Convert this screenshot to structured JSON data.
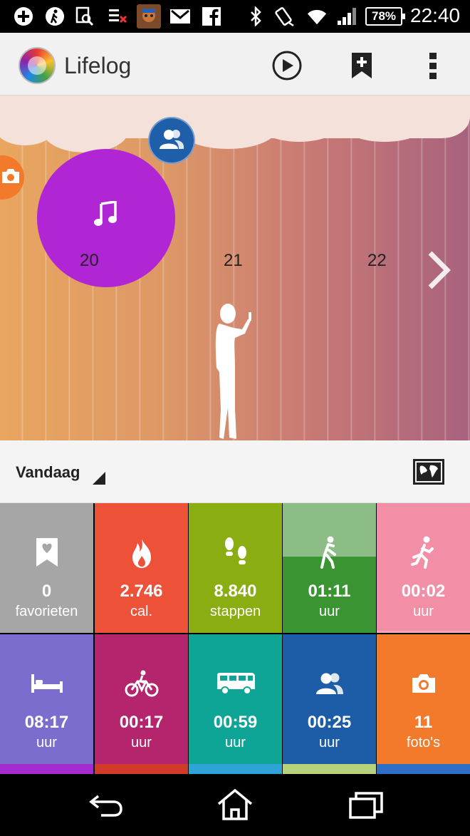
{
  "status_bar": {
    "battery": "78%",
    "time": "22:40"
  },
  "action_bar": {
    "title": "Lifelog",
    "play_icon": "play-circle-icon",
    "bookmark_icon": "bookmark-add-icon",
    "overflow_icon": "overflow-menu-icon"
  },
  "timeline": {
    "days": [
      "20",
      "21",
      "22"
    ],
    "bubbles": [
      "camera-icon",
      "music-note-icon",
      "people-icon"
    ],
    "colors": {
      "music": "#b026d4",
      "people": "#1f5ea8",
      "camera": "#f27a2a"
    }
  },
  "date_header": {
    "label": "Vandaag",
    "map_icon": "world-map-icon"
  },
  "tiles": [
    {
      "value": "0",
      "unit": "favorieten",
      "icon": "bookmark-heart-icon",
      "color": "#a6a6a6"
    },
    {
      "value": "2.746",
      "unit": "cal.",
      "icon": "flame-icon",
      "color": "#ed5138"
    },
    {
      "value": "8.840",
      "unit": "stappen",
      "icon": "footsteps-icon",
      "color": "#8aad12"
    },
    {
      "value": "01:11",
      "unit": "uur",
      "icon": "walking-icon",
      "color": "#3a9432",
      "goal_fraction": 0.59
    },
    {
      "value": "00:02",
      "unit": "uur",
      "icon": "running-icon",
      "color": "#f28fa7"
    },
    {
      "value": "08:17",
      "unit": "uur",
      "icon": "bed-icon",
      "color": "#7b6dcd"
    },
    {
      "value": "00:17",
      "unit": "uur",
      "icon": "bicycle-icon",
      "color": "#b5256d"
    },
    {
      "value": "00:59",
      "unit": "uur",
      "icon": "bus-icon",
      "color": "#0ea597"
    },
    {
      "value": "00:25",
      "unit": "uur",
      "icon": "people-icon",
      "color": "#1d5ca6"
    },
    {
      "value": "11",
      "unit": "foto's",
      "icon": "camera-icon",
      "color": "#f27a2a"
    }
  ]
}
